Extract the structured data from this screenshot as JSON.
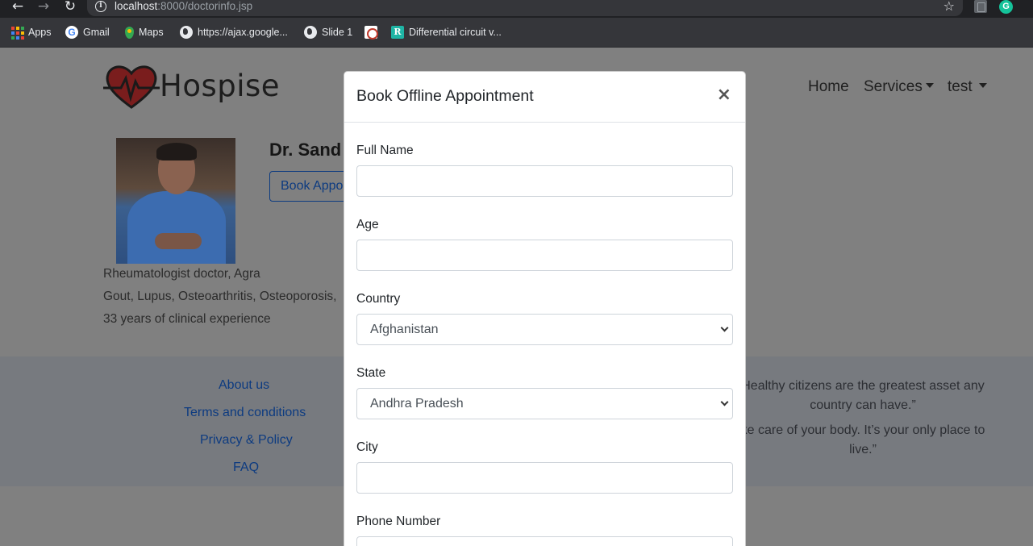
{
  "browser": {
    "url_host": "localhost",
    "url_path": ":8000/doctorinfo.jsp",
    "bookmarks": [
      {
        "label": "Apps",
        "icon": "apps-grid-icon"
      },
      {
        "label": "Gmail",
        "icon": "google-g-icon"
      },
      {
        "label": "Maps",
        "icon": "maps-pin-icon"
      },
      {
        "label": "https://ajax.google...",
        "icon": "globe-icon"
      },
      {
        "label": "Slide 1",
        "icon": "globe-icon"
      },
      {
        "label": "",
        "icon": "slide-thumbnail-icon"
      },
      {
        "label": "Differential circuit v...",
        "icon": "researchgate-r-icon"
      }
    ],
    "grammarly_letter": "G"
  },
  "site": {
    "logo_text": "Hospise",
    "nav": {
      "home": "Home",
      "services": "Services",
      "user": "test"
    }
  },
  "doctor": {
    "name": "Dr. Sand",
    "book_button": "Book Appo",
    "specialty": "Rheumatologist doctor, Agra",
    "conditions": "Gout, Lupus, Osteoarthritis, Osteoporosis,",
    "experience": "33 years of clinical experience"
  },
  "footer": {
    "links": [
      "About us",
      "Terms and conditions",
      "Privacy & Policy",
      "FAQ"
    ],
    "quote1_line1": "Healthy citizens are the greatest asset any",
    "quote1_line2": "country can have.”",
    "quote2_line1": "ke care of your body. It’s your only place to",
    "quote2_line2": "live.”"
  },
  "modal": {
    "title": "Book Offline Appointment",
    "close": "×",
    "fields": {
      "full_name": {
        "label": "Full Name",
        "value": ""
      },
      "age": {
        "label": "Age",
        "value": ""
      },
      "country": {
        "label": "Country",
        "value": "Afghanistan"
      },
      "state": {
        "label": "State",
        "value": "Andhra Pradesh"
      },
      "city": {
        "label": "City",
        "value": ""
      },
      "phone": {
        "label": "Phone Number",
        "value": ""
      }
    }
  },
  "colors": {
    "brand_red": "#d93838",
    "link_blue": "#0d3b80",
    "overlay": "#808080"
  }
}
